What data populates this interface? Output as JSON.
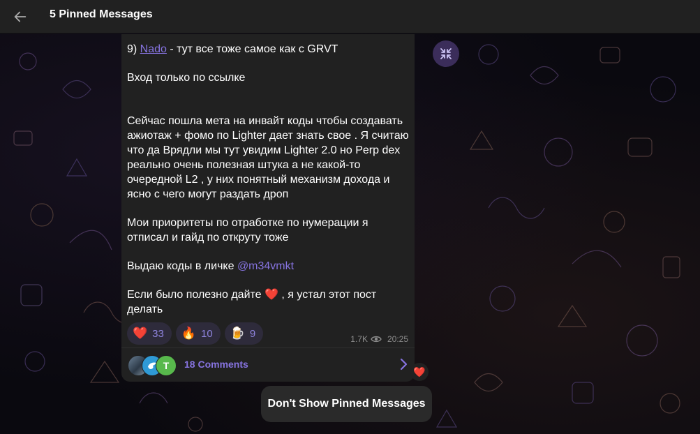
{
  "header": {
    "back_icon": "arrow-left-icon",
    "title": "5 Pinned Messages"
  },
  "message": {
    "line1_prefix": "9) ",
    "line1_link": "Nado",
    "line1_suffix": " - тут все тоже самое как с GRVT",
    "p2": "Вход только по ссылке",
    "p3": "Сейчас пошла мета на инвайт коды чтобы создавать ажиотаж + фомо по Lighter дает знать свое . Я считаю что да Врядли мы тут увидим Lighter 2.0 но Perp dex реально очень полезная штука а не какой-то очередной L2 , у них понятный механизм дохода и ясно с чего могут раздать дроп",
    "p4": "Мои приоритеты по отработке по нумерации я отписал и гайд по открутy тоже",
    "p5_prefix": "Выдаю коды в личке ",
    "p5_mention": "@m34vmkt",
    "p6_prefix": "Если было полезно дайте ",
    "p6_emoji": "❤️",
    "p6_suffix": " , я устал этот пост делать",
    "reactions": [
      {
        "emoji": "❤️",
        "count": "33"
      },
      {
        "emoji": "🔥",
        "count": "10"
      },
      {
        "emoji": "🍺",
        "count": "9"
      }
    ],
    "views": "1.7K",
    "time": "20:25",
    "comments_label": "18 Comments",
    "avatar_letter": "T"
  },
  "unpin_button": "Don't Show Pinned Messages",
  "side_reaction": "❤️",
  "colors": {
    "accent": "#8774e1",
    "bubble": "#212121",
    "topbar": "#212121"
  }
}
